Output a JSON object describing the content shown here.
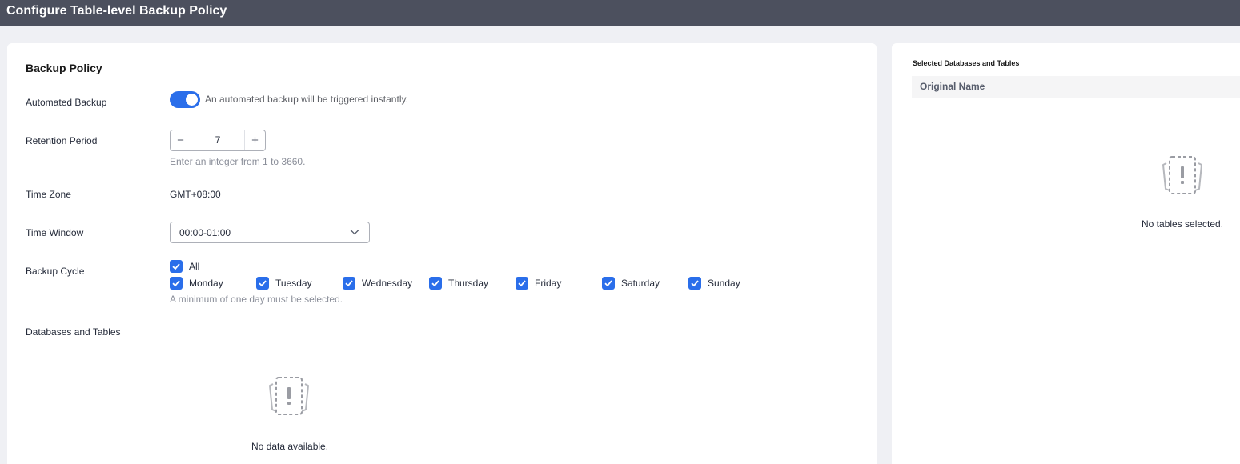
{
  "header": {
    "title": "Configure Table-level Backup Policy"
  },
  "backup_policy": {
    "section_title": "Backup Policy",
    "automated_backup": {
      "label": "Automated Backup",
      "enabled": true,
      "description": "An automated backup will be triggered instantly."
    },
    "retention_period": {
      "label": "Retention Period",
      "value": "7",
      "minus_symbol": "−",
      "plus_symbol": "+",
      "hint": "Enter an integer from 1 to 3660."
    },
    "time_zone": {
      "label": "Time Zone",
      "value": "GMT+08:00"
    },
    "time_window": {
      "label": "Time Window",
      "selected": "00:00-01:00"
    },
    "backup_cycle": {
      "label": "Backup Cycle",
      "all_label": "All",
      "days": [
        "Monday",
        "Tuesday",
        "Wednesday",
        "Thursday",
        "Friday",
        "Saturday",
        "Sunday"
      ],
      "hint": "A minimum of one day must be selected."
    },
    "databases_tables": {
      "label": "Databases and Tables",
      "empty_text": "No data available."
    }
  },
  "selected_panel": {
    "title": "Selected Databases and Tables",
    "column_header": "Original Name",
    "empty_text": "No tables selected."
  },
  "colors": {
    "accent": "#2a6eea",
    "header_bg": "#4c505e",
    "page_bg": "#eff0f4"
  },
  "icons": {
    "empty_state": "empty-document-exclamation-icon",
    "check": "check-icon",
    "dropdown": "chevron-down-icon"
  }
}
